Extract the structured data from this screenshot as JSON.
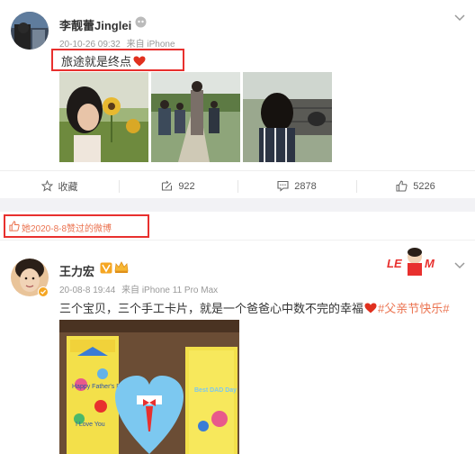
{
  "post1": {
    "author": "李靓蕾Jinglei",
    "timestamp": "20-10-26 09:32",
    "source": "来自 iPhone",
    "text": "旅途就是终点",
    "actions": {
      "favorite_label": "收藏",
      "repost_count": "922",
      "comment_count": "2878",
      "like_count": "5226"
    }
  },
  "liked_notice": {
    "text": "她2020-8-8赞过的微博"
  },
  "post2": {
    "author": "王力宏",
    "timestamp": "20-08-8 19:44",
    "source": "来自 iPhone 11 Pro Max",
    "text": "三个宝贝，三个手工卡片，就是一个爸爸心中数不完的幸福",
    "hashtag": "#父亲节快乐#",
    "card_texts": [
      "Happy Father's Day",
      "I Love You",
      "Best DAD Day"
    ]
  },
  "icons": {
    "verified": "verified-badge-icon",
    "crown": "crown-icon",
    "member": "member-icon",
    "favorite": "star-icon",
    "repost": "repost-icon",
    "comment": "comment-icon",
    "like": "thumbs-up-icon",
    "expand": "chevron-down-icon",
    "heart": "heart-icon"
  },
  "colors": {
    "accent": "#eb7350",
    "highlight_box": "#e8302e",
    "heart": "#e0301e"
  }
}
